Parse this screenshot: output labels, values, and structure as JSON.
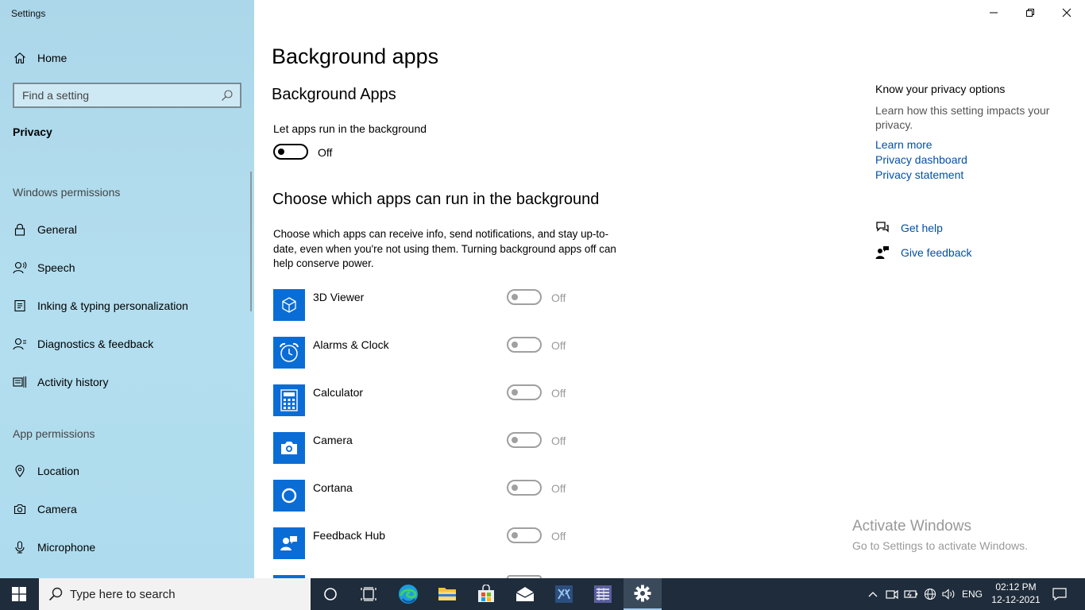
{
  "window": {
    "title": "Settings"
  },
  "sidebar": {
    "home_label": "Home",
    "search_placeholder": "Find a setting",
    "section": "Privacy",
    "windows_permissions_header": "Windows permissions",
    "windows_items": [
      {
        "label": "General",
        "icon": "lock-icon"
      },
      {
        "label": "Speech",
        "icon": "speech-icon"
      },
      {
        "label": "Inking & typing personalization",
        "icon": "inking-icon"
      },
      {
        "label": "Diagnostics & feedback",
        "icon": "diagnostics-icon"
      },
      {
        "label": "Activity history",
        "icon": "activity-history-icon"
      }
    ],
    "app_permissions_header": "App permissions",
    "app_items": [
      {
        "label": "Location",
        "icon": "location-icon"
      },
      {
        "label": "Camera",
        "icon": "camera-icon"
      },
      {
        "label": "Microphone",
        "icon": "microphone-icon"
      }
    ]
  },
  "main": {
    "page_title": "Background apps",
    "section_title": "Background Apps",
    "master_toggle_label": "Let apps run in the background",
    "master_toggle_state": "Off",
    "choose_title": "Choose which apps can run in the background",
    "choose_desc": "Choose which apps can receive info, send notifications, and stay up-to-date, even when you're not using them. Turning background apps off can help conserve power.",
    "apps": [
      {
        "name": "3D Viewer",
        "state": "Off",
        "icon": "3d-viewer-icon"
      },
      {
        "name": "Alarms & Clock",
        "state": "Off",
        "icon": "alarm-clock-icon"
      },
      {
        "name": "Calculator",
        "state": "Off",
        "icon": "calculator-icon"
      },
      {
        "name": "Camera",
        "state": "Off",
        "icon": "camera-app-icon"
      },
      {
        "name": "Cortana",
        "state": "Off",
        "icon": "cortana-icon"
      },
      {
        "name": "Feedback Hub",
        "state": "Off",
        "icon": "feedback-hub-icon"
      }
    ]
  },
  "right_panel": {
    "heading": "Know your privacy options",
    "desc": "Learn how this setting impacts your privacy.",
    "links": [
      "Learn more",
      "Privacy dashboard",
      "Privacy statement"
    ],
    "get_help": "Get help",
    "give_feedback": "Give feedback"
  },
  "watermark": {
    "line1": "Activate Windows",
    "line2": "Go to Settings to activate Windows."
  },
  "taskbar": {
    "search_placeholder": "Type here to search",
    "time": "02:12 PM",
    "date": "12-12-2021",
    "language": "ENG"
  },
  "colors": {
    "accent": "#0a6dd6",
    "link": "#0050a8",
    "sidebar_bg": "#b3deef",
    "taskbar_bg": "#1f2c3b"
  }
}
